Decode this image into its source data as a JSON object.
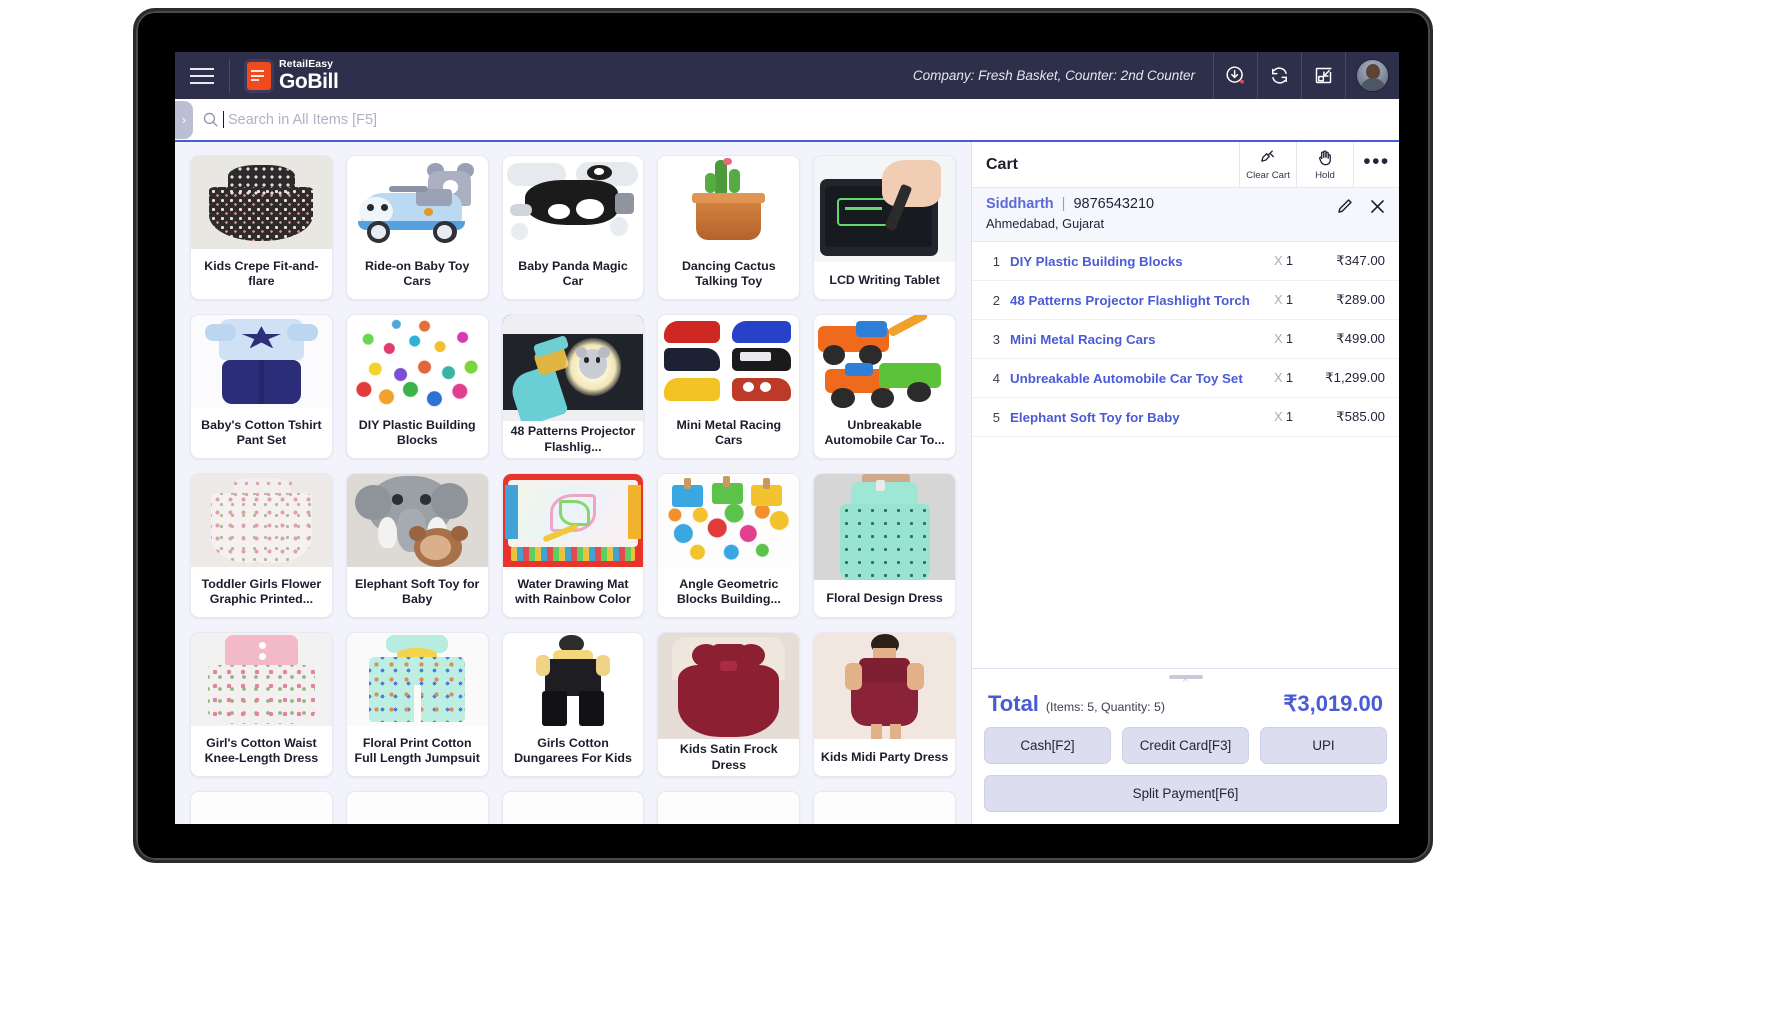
{
  "appbar": {
    "menu_icon": "hamburger-icon",
    "brand_small": "RetailEasy",
    "brand_big": "GoBill",
    "company_info": "Company: Fresh Basket,  Counter: 2nd Counter",
    "icons": [
      {
        "name": "download-clock-icon",
        "badge": true
      },
      {
        "name": "sync-refresh-icon",
        "badge": false
      },
      {
        "name": "minimize-restore-icon",
        "badge": false
      }
    ],
    "avatar_name": "user-avatar"
  },
  "search": {
    "placeholder": "Search in All Items [F5]",
    "value": "",
    "icon": "search-icon",
    "sidebar_toggle_icon": "chevron-right-icon"
  },
  "grid": {
    "products": [
      {
        "name": "Kids Crepe Fit-and-flare",
        "img": "floral-black-dress"
      },
      {
        "name": "Ride-on Baby Toy Cars",
        "img": "blue-ride-on-car"
      },
      {
        "name": "Baby Panda Magic Car",
        "img": "black-white-swing-car"
      },
      {
        "name": "Dancing Cactus Talking Toy",
        "img": "dancing-cactus"
      },
      {
        "name": "LCD Writing Tablet",
        "img": "lcd-writing-tablet"
      },
      {
        "name": "Baby's Cotton Tshirt Pant Set",
        "img": "blue-tshirt-pant-set"
      },
      {
        "name": "DIY Plastic Building Blocks",
        "img": "colorful-building-blocks"
      },
      {
        "name": "48 Patterns Projector Flashlig...",
        "img": "projector-flashlight"
      },
      {
        "name": "Mini Metal Racing Cars",
        "img": "metal-racing-cars"
      },
      {
        "name": "Unbreakable Automobile Car To...",
        "img": "construction-toy-trucks"
      },
      {
        "name": "Toddler Girls Flower Graphic Printed...",
        "img": "white-floral-dress"
      },
      {
        "name": "Elephant Soft Toy for Baby",
        "img": "grey-elephant-plush"
      },
      {
        "name": "Water Drawing Mat with Rainbow Color",
        "img": "water-drawing-mat"
      },
      {
        "name": "Angle Geometric Blocks Building...",
        "img": "geometric-wooden-blocks"
      },
      {
        "name": "Floral Design Dress",
        "img": "mint-floral-dress"
      },
      {
        "name": "Girl's Cotton Waist Knee-Length Dress",
        "img": "pink-white-floral-dress"
      },
      {
        "name": "Floral Print Cotton Full Length Jumpsuit",
        "img": "mint-polkadot-jumpsuit"
      },
      {
        "name": "Girls Cotton Dungarees For Kids",
        "img": "black-dungarees"
      },
      {
        "name": "Kids Satin Frock Dress",
        "img": "maroon-satin-frock"
      },
      {
        "name": "Kids Midi Party Dress",
        "img": "maroon-midi-dress"
      },
      {
        "name": "",
        "img": "placeholder"
      },
      {
        "name": "",
        "img": "placeholder"
      },
      {
        "name": "",
        "img": "placeholder"
      },
      {
        "name": "",
        "img": "placeholder"
      },
      {
        "name": "",
        "img": "placeholder"
      }
    ]
  },
  "cart": {
    "title": "Cart",
    "actions": [
      {
        "name": "clear-cart",
        "label": "Clear Cart",
        "icon": "broom-icon"
      },
      {
        "name": "hold",
        "label": "Hold",
        "icon": "hand-icon"
      }
    ],
    "more_icon": "more-dots-icon",
    "customer": {
      "name": "Siddharth",
      "separator": "|",
      "phone": "9876543210",
      "address": "Ahmedabad, Gujarat",
      "edit_icon": "pencil-icon",
      "remove_icon": "close-icon"
    },
    "items": [
      {
        "index": "1",
        "name": "DIY Plastic Building Blocks",
        "qty_prefix": "X",
        "qty": "1",
        "price": "₹347.00"
      },
      {
        "index": "2",
        "name": "48 Patterns Projector Flashlight Torch",
        "qty_prefix": "X",
        "qty": "1",
        "price": "₹289.00"
      },
      {
        "index": "3",
        "name": "Mini Metal Racing Cars",
        "qty_prefix": "X",
        "qty": "1",
        "price": "₹499.00"
      },
      {
        "index": "4",
        "name": "Unbreakable Automobile Car Toy Set",
        "qty_prefix": "X",
        "qty": "1",
        "price": "₹1,299.00"
      },
      {
        "index": "5",
        "name": "Elephant Soft Toy for Baby",
        "qty_prefix": "X",
        "qty": "1",
        "price": "₹585.00"
      }
    ],
    "total": {
      "label": "Total",
      "sub": "(Items: 5, Quantity: 5)",
      "amount": "₹3,019.00"
    },
    "payments": [
      {
        "name": "cash",
        "label": "Cash[F2]"
      },
      {
        "name": "credit-card",
        "label": "Credit Card[F3]"
      },
      {
        "name": "upi",
        "label": "UPI"
      }
    ],
    "split_payment_label": "Split Payment[F6]"
  },
  "colors": {
    "appbar_bg": "#2e2f4a",
    "accent": "#4a5bd6",
    "brand_mark": "#f04a1e",
    "panel_bg": "#f3f4fb",
    "pay_button": "#dcdef0"
  }
}
